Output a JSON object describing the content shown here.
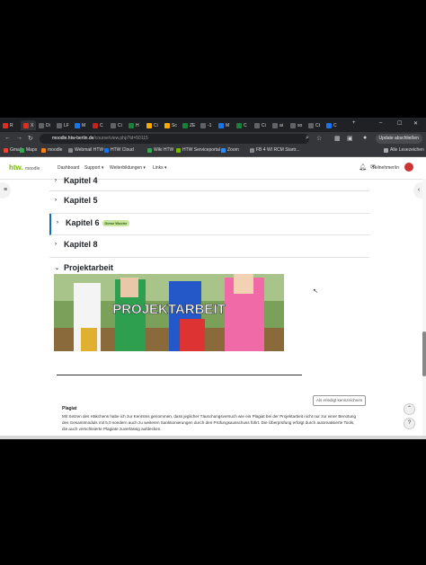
{
  "browser": {
    "tabs": [
      {
        "label": "R",
        "color": "#d93025"
      },
      {
        "label": "X",
        "color": "#d93025"
      },
      {
        "label": "Di",
        "color": "#5f6368"
      },
      {
        "label": "LF",
        "color": "#5f6368"
      },
      {
        "label": "M",
        "color": "#1a73e8"
      },
      {
        "label": "C",
        "color": "#c5221f"
      },
      {
        "label": "Ci",
        "color": "#5f6368"
      },
      {
        "label": "H",
        "color": "#188038"
      },
      {
        "label": "Ci",
        "color": "#f9ab00"
      },
      {
        "label": "Sc",
        "color": "#f9ab00"
      },
      {
        "label": "ZE",
        "color": "#188038"
      },
      {
        "label": "-1",
        "color": "#5f6368"
      },
      {
        "label": "M",
        "color": "#1a73e8"
      },
      {
        "label": "C",
        "color": "#188038"
      },
      {
        "label": "Ci",
        "color": "#5f6368"
      },
      {
        "label": "ai",
        "color": "#5f6368"
      },
      {
        "label": "so",
        "color": "#5f6368"
      },
      {
        "label": "Ct",
        "color": "#5f6368"
      },
      {
        "label": "C",
        "color": "#1a73e8"
      }
    ],
    "url_host": "moodle.htw-berlin.de",
    "url_path": "/course/view.php?id=50115",
    "update_label": "Update abschließen",
    "bookmarks": [
      {
        "label": "Gmail",
        "color": "#ea4335"
      },
      {
        "label": "Maps",
        "color": "#34a853"
      },
      {
        "label": "moodle",
        "color": "#f98012"
      },
      {
        "label": "Webmail HTW",
        "color": "#888"
      },
      {
        "label": "HTW Cloud",
        "color": "#1a73e8"
      },
      {
        "label": "Wiki HTW",
        "color": "#34a853"
      },
      {
        "label": "HTW Serviceportal",
        "color": "#76b900"
      },
      {
        "label": "Zoom",
        "color": "#2d8cff"
      },
      {
        "label": "FB 4 WI RCM Startr...",
        "color": "#888"
      }
    ],
    "all_bookmarks": "Alle Lesezeichen"
  },
  "moodle": {
    "logo": "htw.",
    "logo_sub": "moodle",
    "nav": [
      "Dashboard",
      "Support ▾",
      "Weiterbildungen ▾",
      "Links ▾"
    ],
    "user_name": "Teilnehmer/in",
    "sections": [
      {
        "title": "Kapitel 4"
      },
      {
        "title": "Kapitel 5"
      },
      {
        "title": "Kapitel 6",
        "badge": "Diese Woche"
      },
      {
        "title": "Kapitel 8"
      }
    ],
    "project_title": "Projektarbeit",
    "banner_text": "PROJEKTARBEIT",
    "mark_done": "Als erledigt kennzeichnen",
    "plagiat_heading": "Plagiat",
    "plagiat_text": "Mit Setzen des Häkchens habe ich zur Kenntnis genommen, dass jeglicher Täuschungsversuch wie ein Plagiat bei der Projektarbeit nicht nur zur einer Benotung des Gesamtmoduls mit 5,0 sondern auch zu weiteren Sanktionierungen durch den Prüfungsausschuss führt. Die Überprüfung erfolgt durch automatisierte Tools, die auch verschleierte Plagiate zuverlässig aufdecken."
  }
}
